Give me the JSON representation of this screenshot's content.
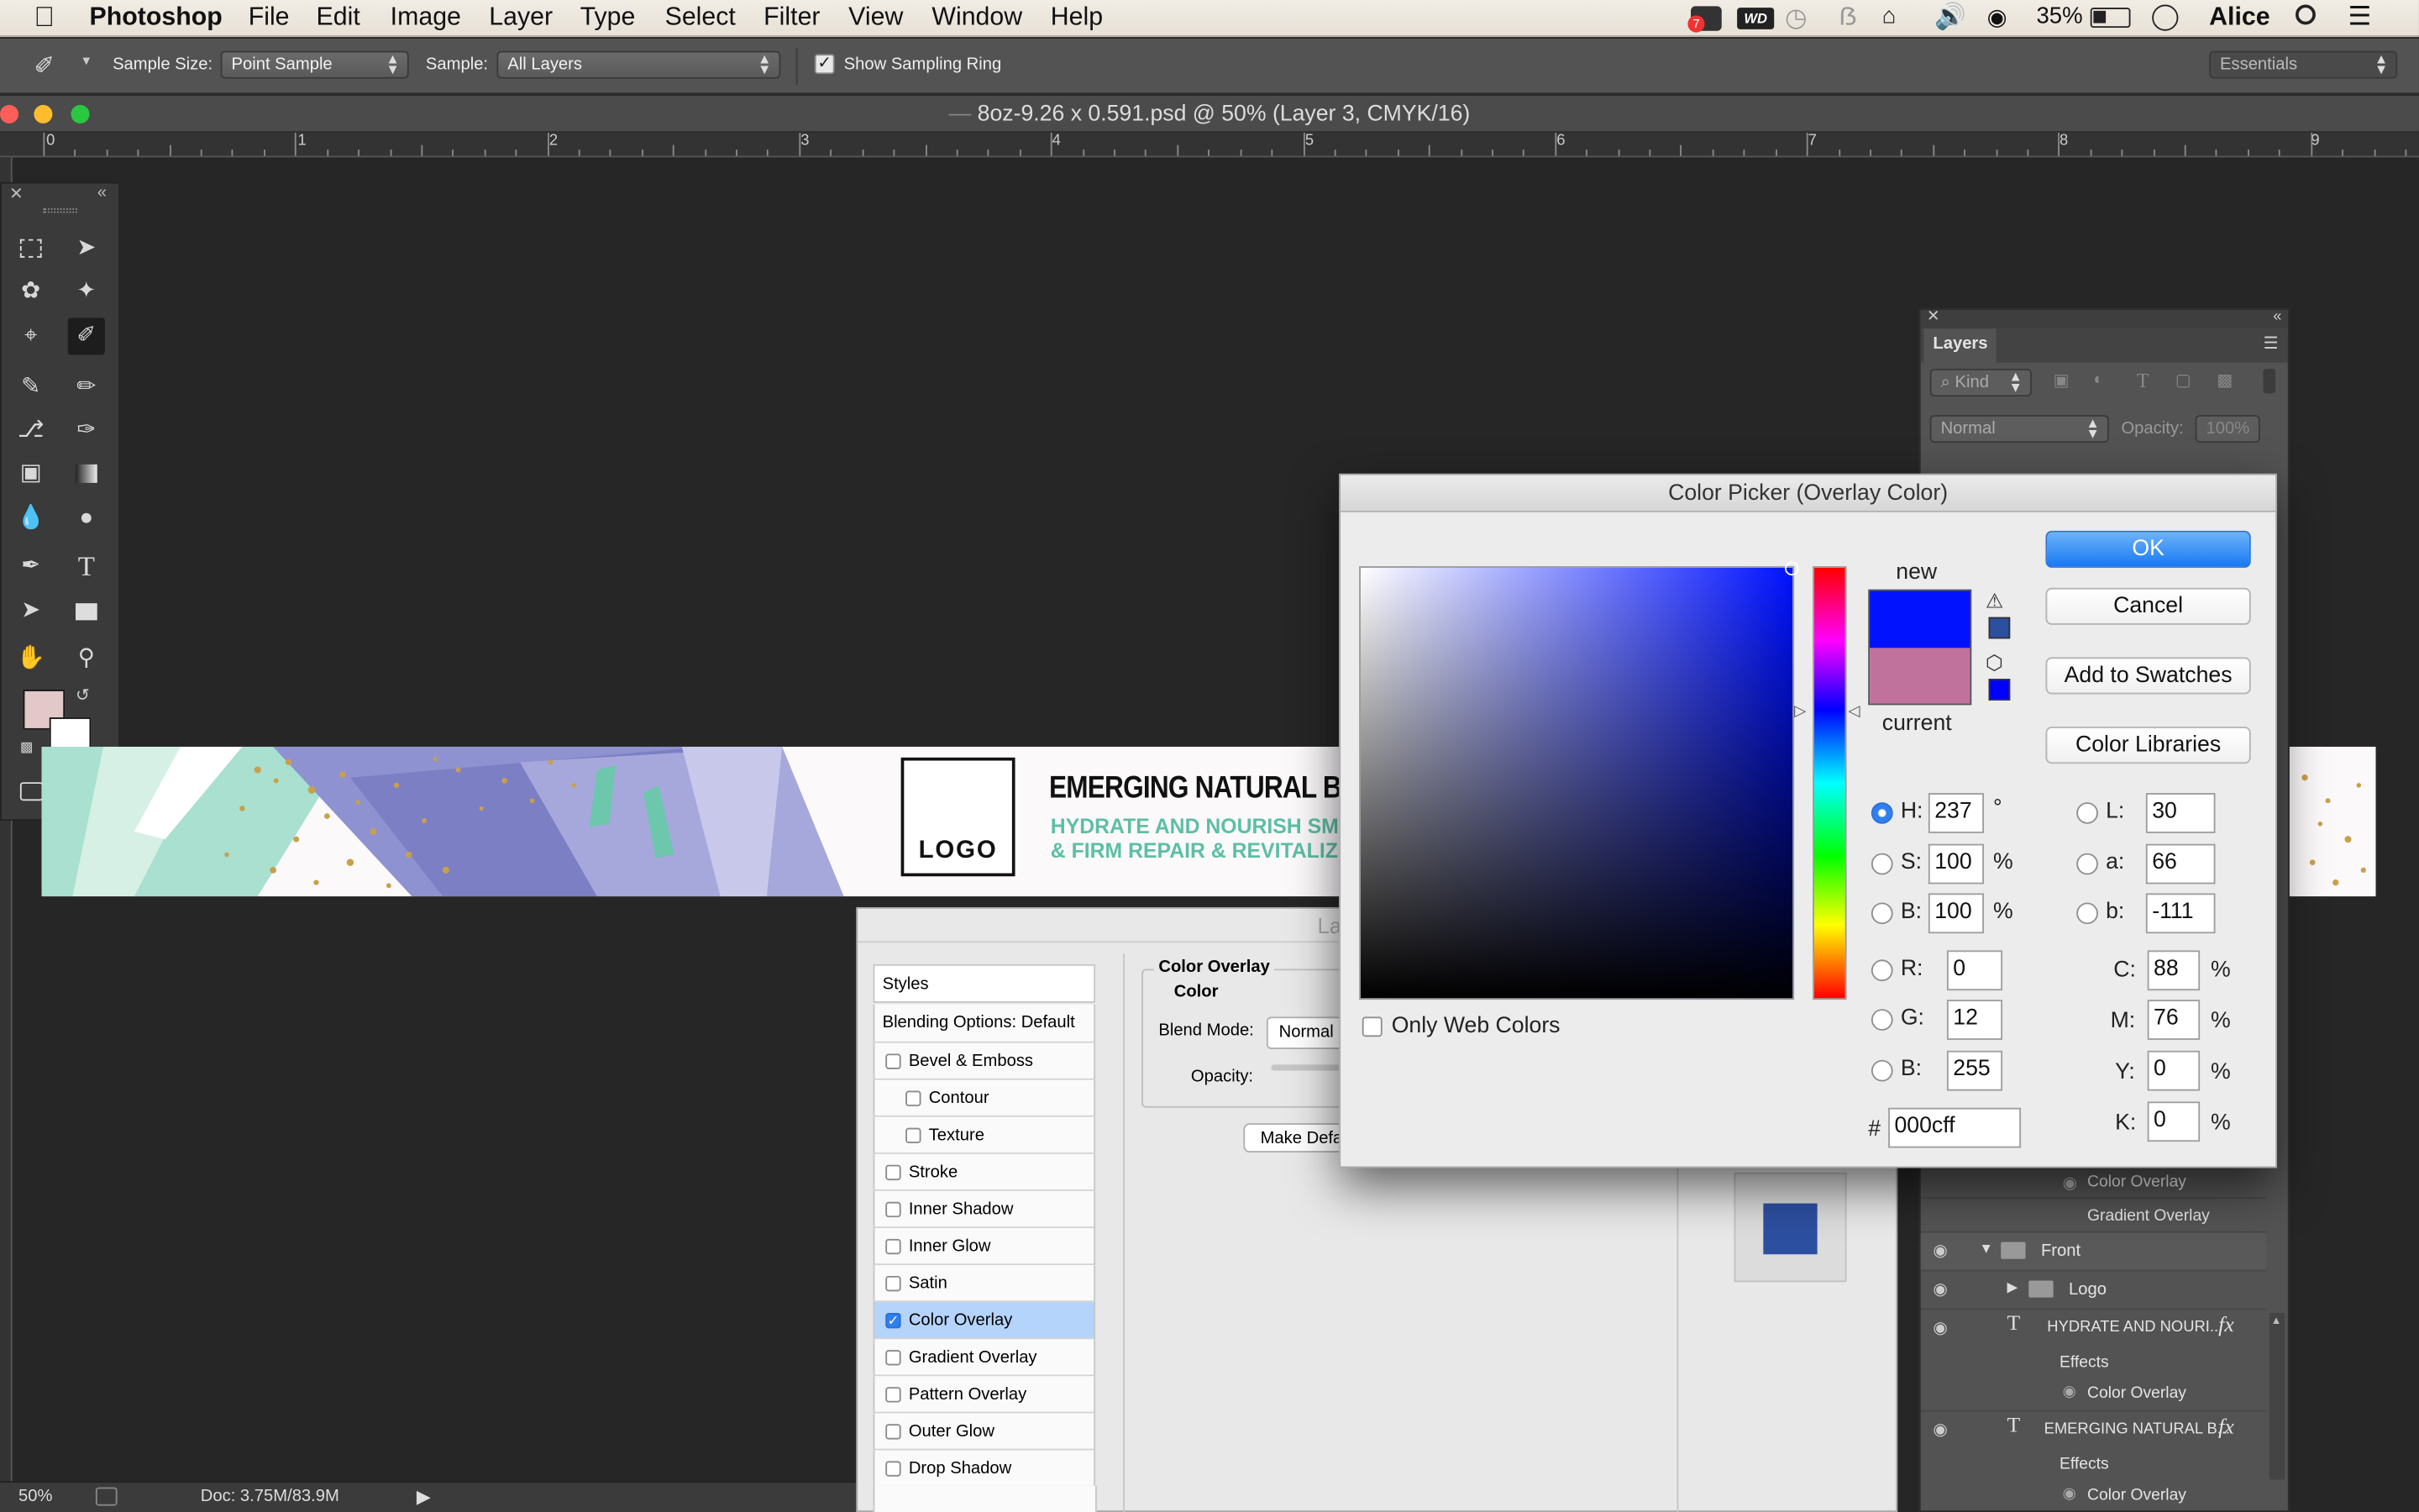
{
  "menubar": {
    "app": "Photoshop",
    "items": [
      "File",
      "Edit",
      "Image",
      "Layer",
      "Type",
      "Select",
      "Filter",
      "View",
      "Window",
      "Help"
    ],
    "battery": "35%",
    "user": "Alice",
    "badge": "7",
    "wd_label": "WD"
  },
  "options": {
    "sample_size_label": "Sample Size:",
    "sample_size_value": "Point Sample",
    "sample_label": "Sample:",
    "sample_value": "All Layers",
    "show_ring": "Show Sampling Ring",
    "workspace": "Essentials"
  },
  "document": {
    "title": "8oz-9.26 x 0.591.psd @ 50% (Layer 3, CMYK/16)",
    "ruler_labels": [
      "0",
      "1",
      "2",
      "3",
      "4",
      "5",
      "6",
      "7",
      "8",
      "9"
    ]
  },
  "banner": {
    "logo": "LOGO",
    "headline": "EMERGING NATURAL BEAU",
    "line1": "HYDRATE AND NOURISH SM",
    "line2": "& FIRM REPAIR & REVITALIZ"
  },
  "status": {
    "zoom": "50%",
    "doc": "Doc: 3.75M/83.9M"
  },
  "layers": {
    "tab": "Layers",
    "kind": "Kind",
    "blend": "Normal",
    "opacity_label": "Opacity:",
    "opacity_value": "100%",
    "rows": {
      "r1": "Color Overlay",
      "r2": "Gradient Overlay",
      "r3": "Front",
      "r4": "Logo",
      "r5": "HYDRATE AND NOURI...",
      "r6": "Effects",
      "r7": "Color Overlay",
      "r8": "EMERGING NATURAL B...",
      "r9": "Effects",
      "r10": "Color Overlay"
    },
    "fx": "fx"
  },
  "layer_style": {
    "title_fragment": "La",
    "styles": "Styles",
    "blending": "Blending Options: Default",
    "items": [
      "Bevel & Emboss",
      "Contour",
      "Texture",
      "Stroke",
      "Inner Shadow",
      "Inner Glow",
      "Satin",
      "Color Overlay",
      "Gradient Overlay",
      "Pattern Overlay",
      "Outer Glow",
      "Drop Shadow"
    ],
    "section": "Color Overlay",
    "subsection": "Color",
    "blend_mode_label": "Blend Mode:",
    "blend_mode_value": "Normal",
    "opacity_label": "Opacity:",
    "make_default": "Make Defa"
  },
  "picker": {
    "title": "Color Picker (Overlay Color)",
    "new_label": "new",
    "current_label": "current",
    "ok": "OK",
    "cancel": "Cancel",
    "add_swatches": "Add to Swatches",
    "libraries": "Color Libraries",
    "only_web": "Only Web Colors",
    "fields": {
      "H": {
        "label": "H:",
        "value": "237",
        "unit": "°"
      },
      "S": {
        "label": "S:",
        "value": "100",
        "unit": "%"
      },
      "Bv": {
        "label": "B:",
        "value": "100",
        "unit": "%"
      },
      "R": {
        "label": "R:",
        "value": "0"
      },
      "G": {
        "label": "G:",
        "value": "12"
      },
      "Bb": {
        "label": "B:",
        "value": "255"
      },
      "L": {
        "label": "L:",
        "value": "30"
      },
      "a": {
        "label": "a:",
        "value": "66"
      },
      "b": {
        "label": "b:",
        "value": "-111"
      },
      "C": {
        "label": "C:",
        "value": "88",
        "unit": "%"
      },
      "M": {
        "label": "M:",
        "value": "76",
        "unit": "%"
      },
      "Y": {
        "label": "Y:",
        "value": "0",
        "unit": "%"
      },
      "K": {
        "label": "K:",
        "value": "0",
        "unit": "%"
      }
    },
    "hash": "#",
    "hex": "000cff",
    "new_color": "#0012ff",
    "current_color": "#c0729d"
  },
  "colors": {
    "accent": "#1979f2",
    "teal_text": "#5cbfa4",
    "fg_swatch": "#e2c8c8",
    "preview_swatch": "#2d4fa0"
  }
}
